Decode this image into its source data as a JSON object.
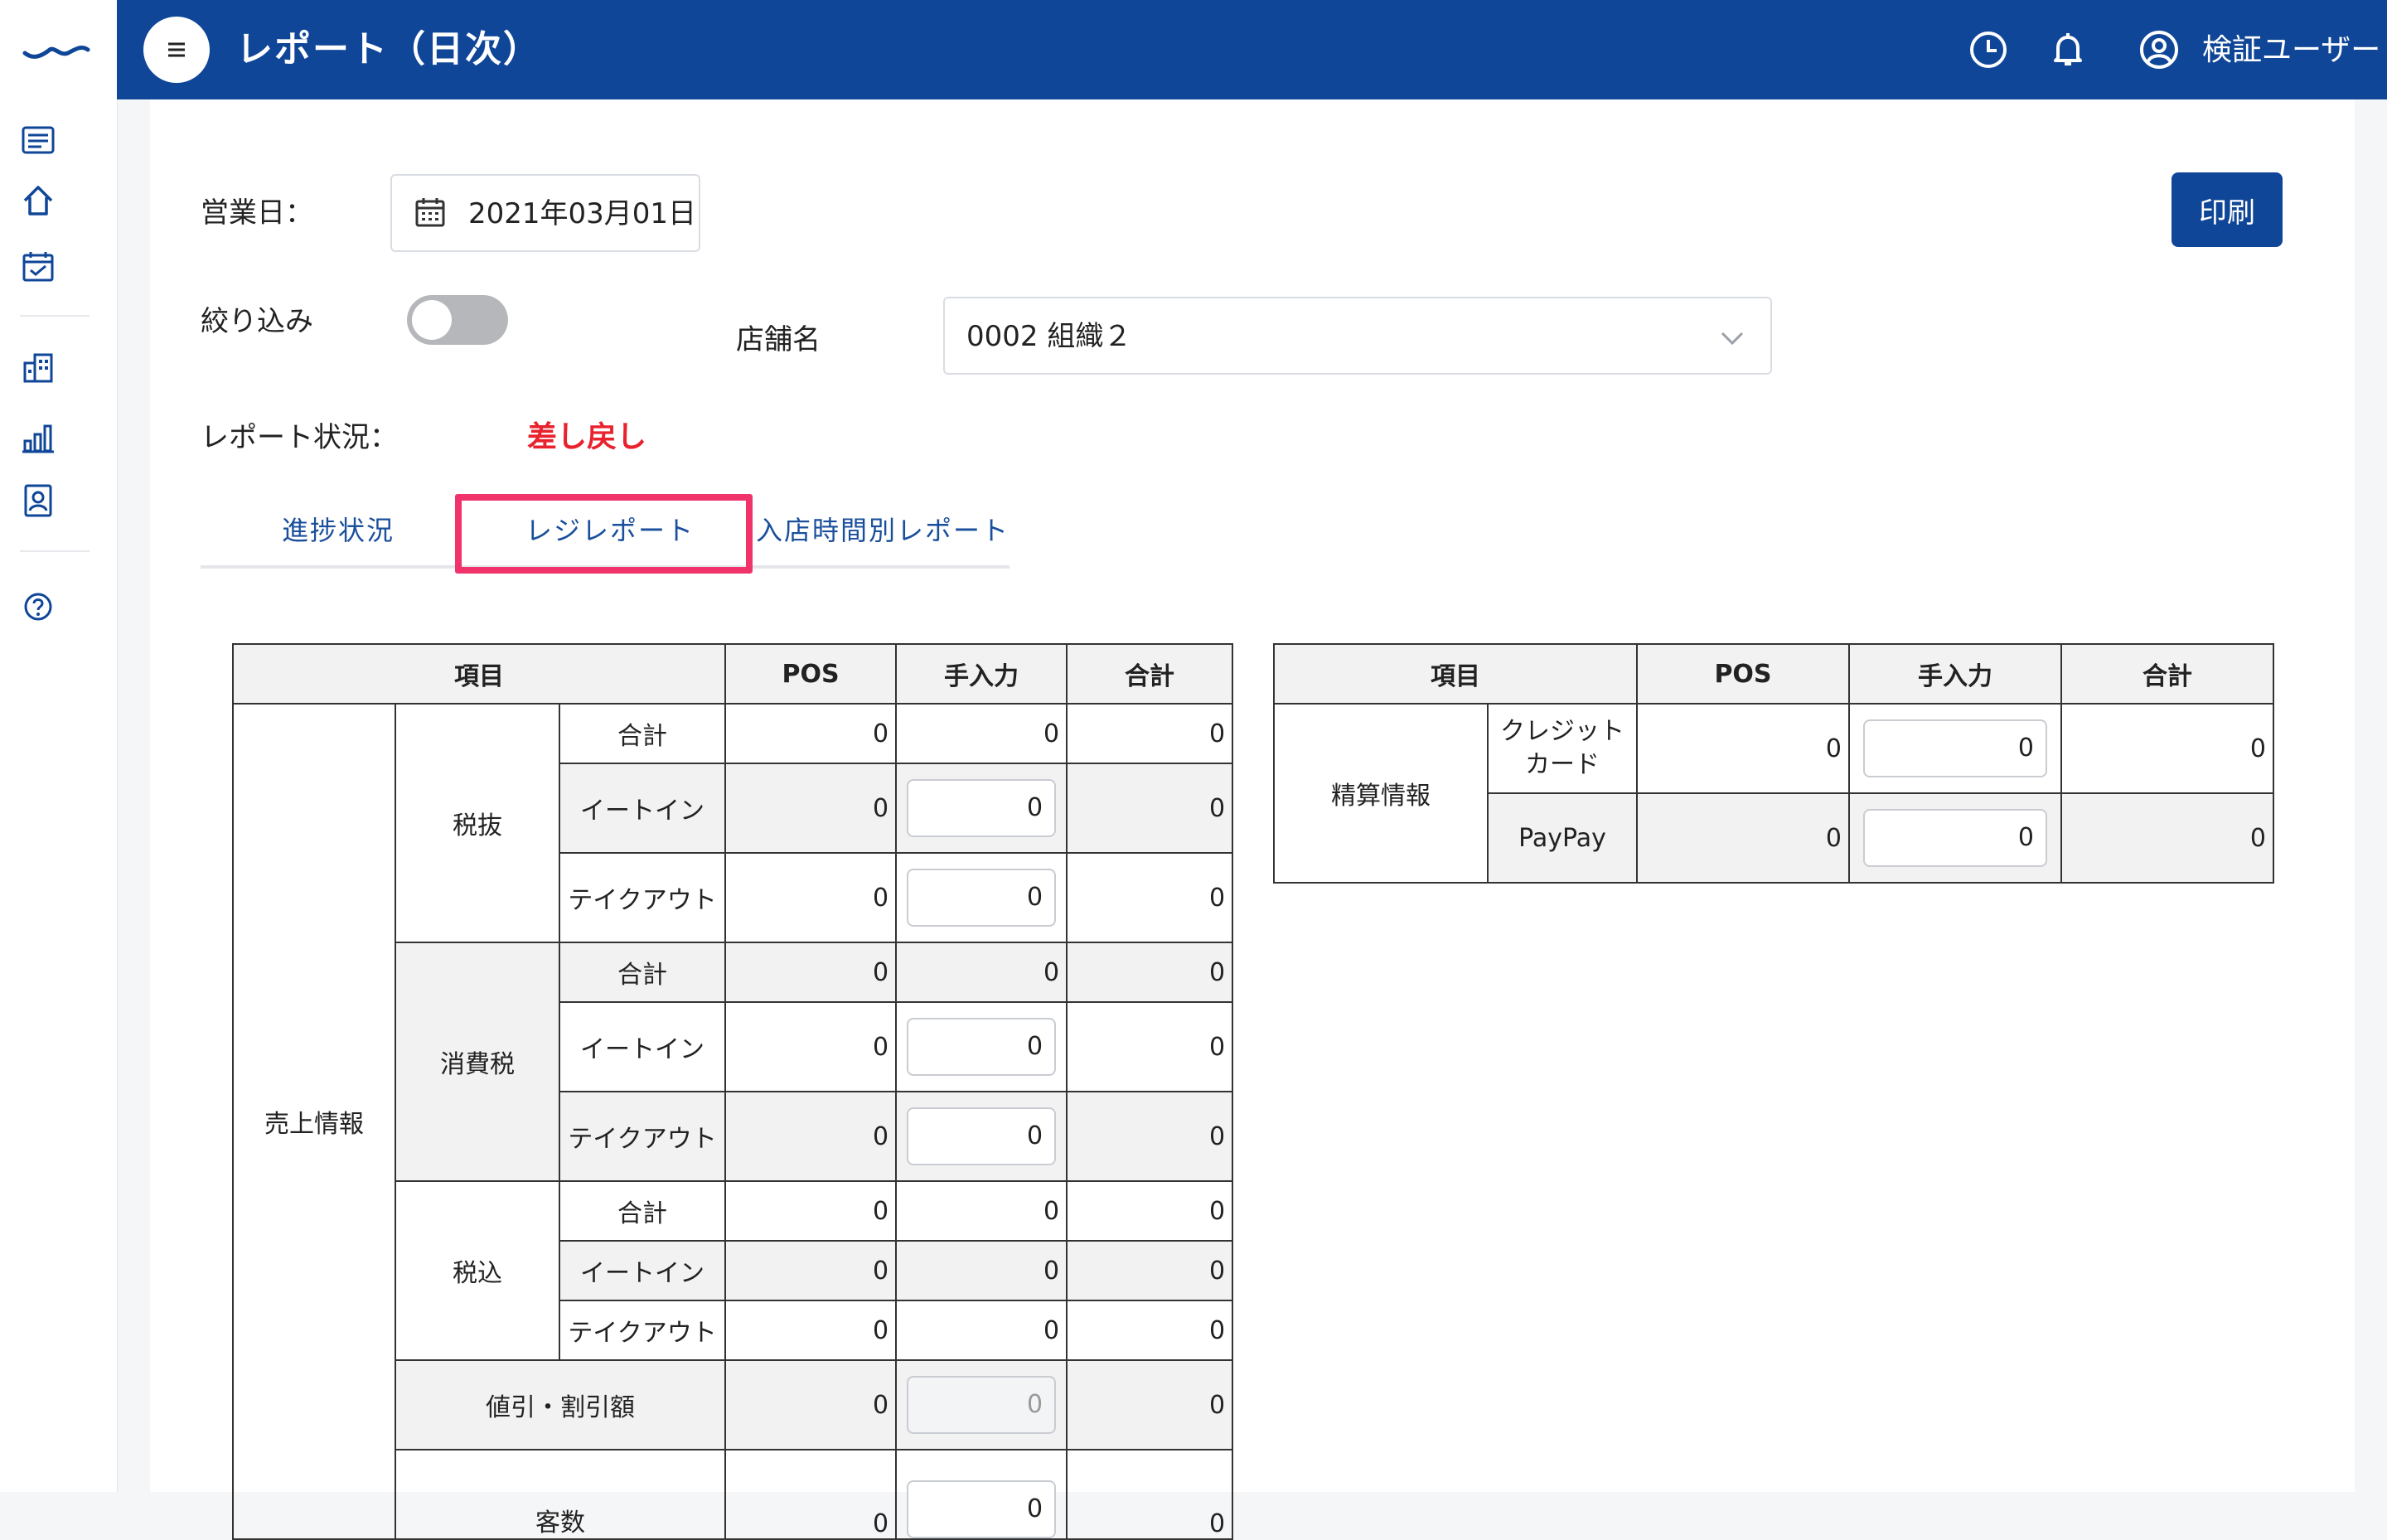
{
  "header": {
    "title": "レポート（日次）",
    "user_name": "検証ユーザー"
  },
  "sidebar": {
    "icons": [
      "list-icon",
      "home-icon",
      "calendar-check-icon",
      "building-icon",
      "bar-chart-icon",
      "id-card-icon",
      "help-icon"
    ]
  },
  "filters": {
    "business_date_label": "営業日：",
    "business_date_value": "2021年03月01日",
    "print_label": "印刷",
    "narrow_label": "絞り込み",
    "store_label": "店舗名",
    "store_value": "0002 組織２",
    "report_status_label": "レポート状況：",
    "report_status_value": "差し戻し"
  },
  "tabs": [
    {
      "label": "進捗状況"
    },
    {
      "label": "レジレポート"
    },
    {
      "label": "入店時間別レポート"
    }
  ],
  "sales_table": {
    "headers": {
      "item": "項目",
      "pos": "POS",
      "manual": "手入力",
      "total": "合計"
    },
    "group_label": "売上情報",
    "sub_tax_excl": "税抜",
    "sub_tax": "消費税",
    "sub_tax_incl": "税込",
    "row_total": "合計",
    "row_eatin": "イートイン",
    "row_takeout": "テイクアウト",
    "discount_label": "値引・割引額",
    "partial_label": "客数",
    "zero": "0"
  },
  "settlement_table": {
    "headers": {
      "item": "項目",
      "pos": "POS",
      "manual": "手入力",
      "total": "合計"
    },
    "group_label": "精算情報",
    "credit_line1": "クレジット",
    "credit_line2": "カード",
    "paypay": "PayPay",
    "zero": "0"
  }
}
